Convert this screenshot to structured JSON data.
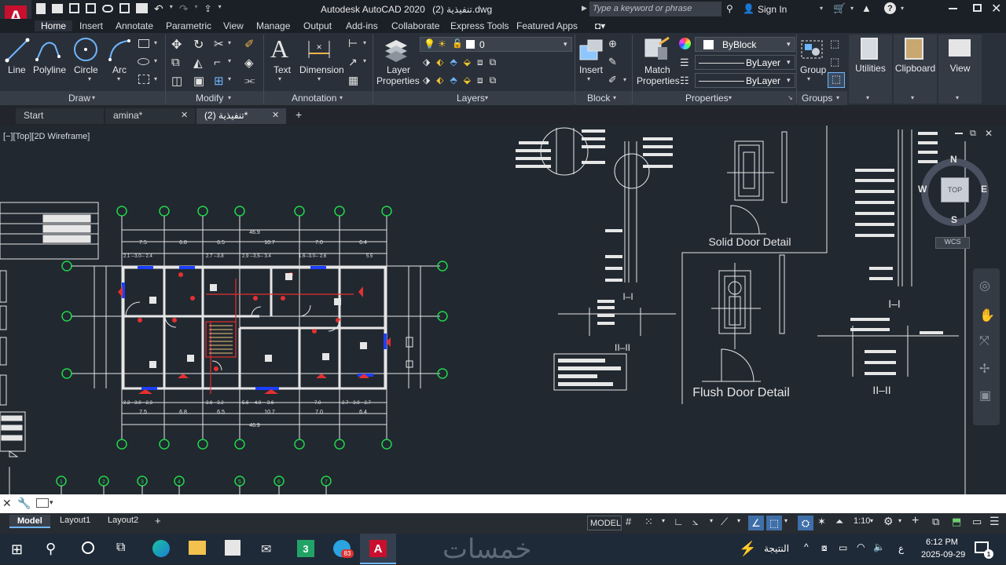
{
  "titlebar": {
    "title": "Autodesk AutoCAD 2020",
    "filename": "تنفيذية (2).dwg",
    "search_placeholder": "Type a keyword or phrase",
    "sign_in": "Sign In",
    "help": "?"
  },
  "ribbon_tabs": [
    "Home",
    "Insert",
    "Annotate",
    "Parametric",
    "View",
    "Manage",
    "Output",
    "Add-ins",
    "Collaborate",
    "Express Tools",
    "Featured Apps"
  ],
  "draw": {
    "line": "Line",
    "polyline": "Polyline",
    "circle": "Circle",
    "arc": "Arc",
    "panel": "Draw"
  },
  "modify": {
    "panel": "Modify"
  },
  "annotation": {
    "text": "Text",
    "dimension": "Dimension",
    "panel": "Annotation"
  },
  "layers": {
    "layer_properties_1": "Layer",
    "layer_properties_2": "Properties",
    "current_layer": "0",
    "panel": "Layers"
  },
  "block": {
    "insert": "Insert",
    "panel": "Block"
  },
  "properties": {
    "match_1": "Match",
    "match_2": "Properties",
    "color": "ByBlock",
    "linetype": "ByLayer",
    "lineweight": "ByLayer",
    "panel": "Properties"
  },
  "groups": {
    "group": "Group",
    "panel": "Groups"
  },
  "utilities": {
    "label": "Utilities"
  },
  "clipboard": {
    "label": "Clipboard"
  },
  "view": {
    "label": "View"
  },
  "doc_tabs": {
    "start": "Start",
    "tab1": "amina*",
    "tab2": "تنفيذية (2)*",
    "add": "+"
  },
  "viewport": {
    "label": "[−][Top][2D Wireframe]",
    "cube_top": "TOP",
    "north": "N",
    "south": "S",
    "east": "E",
    "west": "W",
    "wcs": "WCS"
  },
  "drawing": {
    "solid_door": "Solid Door Detail",
    "flush_door": "Flush Door Detail",
    "sec_i": "I–I",
    "sec_ii": "II–II",
    "total_dim": "46.9",
    "top_dims": [
      "7.5",
      "6.8",
      "6.5",
      "10.7",
      "7.0",
      "6.4"
    ],
    "bottom_dims": [
      "7.5",
      "6.8",
      "6.5",
      "10.7",
      "7.0",
      "6.4"
    ],
    "axes_top": [
      "1",
      "2",
      "3",
      "4",
      "5",
      "6",
      "7"
    ]
  },
  "command": {
    "placeholder": ""
  },
  "layout_tabs": {
    "model": "Model",
    "layout1": "Layout1",
    "layout2": "Layout2",
    "add": "+"
  },
  "statusbar": {
    "model": "MODEL",
    "scale": "1:10"
  },
  "taskbar": {
    "result_label": "النتيجة",
    "time": "6:12 PM",
    "date": "2025-09-29",
    "lang": "ع",
    "notif_count": "1",
    "badge": "83",
    "watermark": "خمسات"
  }
}
